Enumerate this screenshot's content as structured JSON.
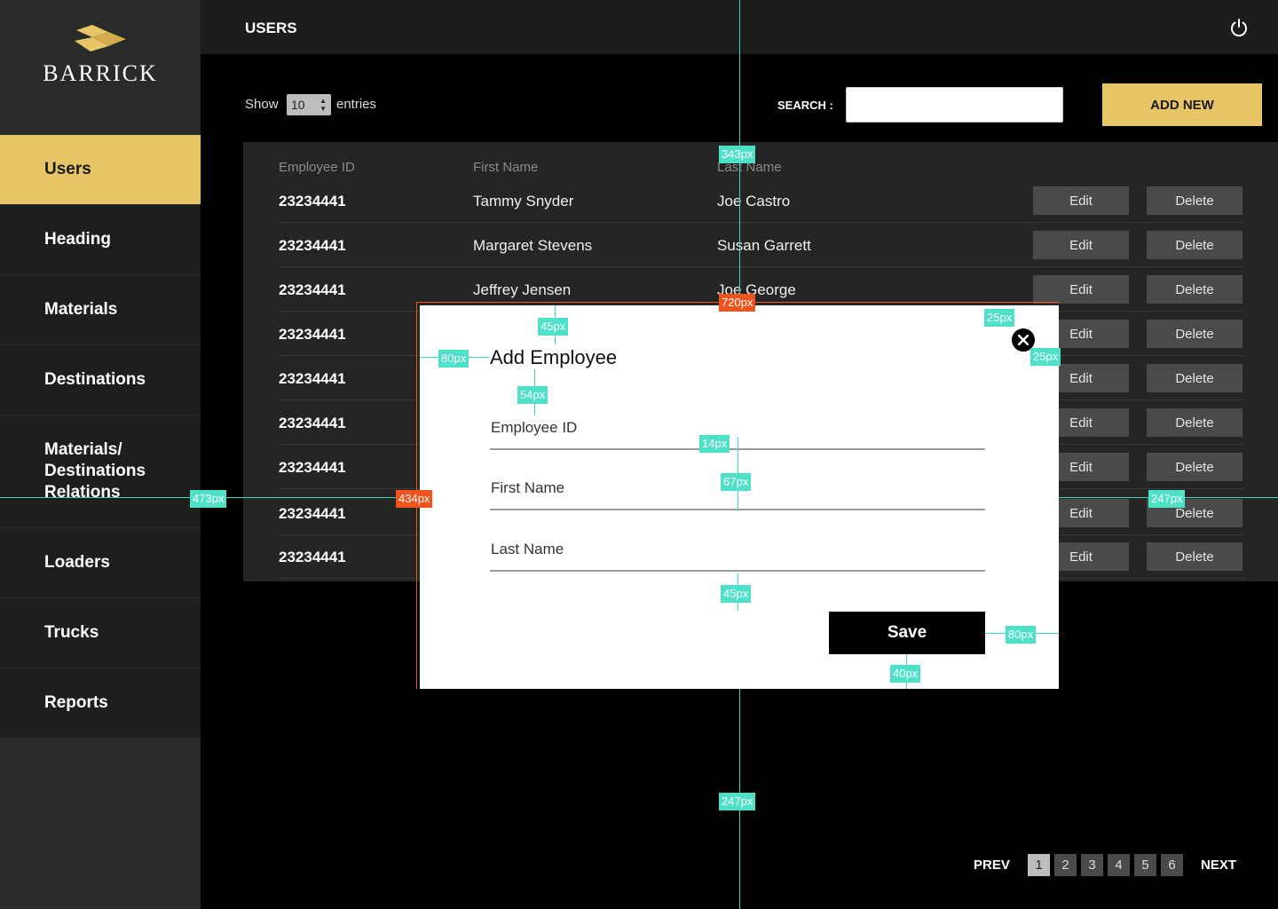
{
  "brand": {
    "name": "BARRICK",
    "gold": "#e8c566"
  },
  "sidebar": {
    "items": [
      {
        "label": "Users",
        "active": true
      },
      {
        "label": "Heading"
      },
      {
        "label": "Materials"
      },
      {
        "label": "Destinations"
      },
      {
        "label": "Materials/ Destinations Relations"
      },
      {
        "label": "Loaders"
      },
      {
        "label": "Trucks"
      },
      {
        "label": "Reports"
      }
    ]
  },
  "header": {
    "title": "USERS",
    "power_icon": "power-icon"
  },
  "controls": {
    "show_label": "Show",
    "entries_value": "10",
    "entries_label": "entries",
    "search_label": "SEARCH :",
    "search_value": "",
    "add_new_label": "ADD NEW"
  },
  "table": {
    "columns": [
      "Employee ID",
      "First Name",
      "Last Name"
    ],
    "rows": [
      {
        "id": "23234441",
        "first": "Tammy Snyder",
        "last": "Joe Castro"
      },
      {
        "id": "23234441",
        "first": "Margaret Stevens",
        "last": "Susan Garrett"
      },
      {
        "id": "23234441",
        "first": "Jeffrey Jensen",
        "last": "Joe George"
      },
      {
        "id": "23234441",
        "first": "",
        "last": ""
      },
      {
        "id": "23234441",
        "first": "",
        "last": ""
      },
      {
        "id": "23234441",
        "first": "",
        "last": ""
      },
      {
        "id": "23234441",
        "first": "",
        "last": ""
      },
      {
        "id": "23234441",
        "first": "",
        "last": ""
      },
      {
        "id": "23234441",
        "first": "",
        "last": ""
      }
    ],
    "edit_label": "Edit",
    "delete_label": "Delete"
  },
  "pagination": {
    "prev": "PREV",
    "next": "NEXT",
    "pages": [
      "1",
      "2",
      "3",
      "4",
      "5",
      "6"
    ],
    "current": "1"
  },
  "modal": {
    "title": "Add Employee",
    "fields": [
      "Employee ID",
      "First Name",
      "Last Name"
    ],
    "save_label": "Save",
    "close_icon": "close-icon"
  },
  "measurements": {
    "m343": "343px",
    "m720": "720px",
    "m45a": "45px",
    "m25a": "25px",
    "m25b": "25px",
    "m80a": "80px",
    "m54": "54px",
    "m14": "14px",
    "m67": "67px",
    "m473": "473px",
    "m434": "434px",
    "m247a": "247px",
    "m45b": "45px",
    "m80b": "80px",
    "m40": "40px",
    "m247b": "247px"
  }
}
